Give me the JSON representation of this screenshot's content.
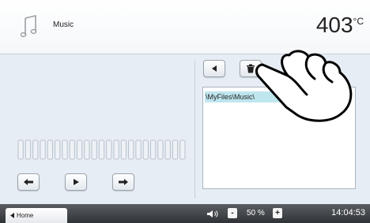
{
  "header": {
    "app_icon": "music-note-icon",
    "title": "Music",
    "temperature": "403",
    "temperature_unit": "°C"
  },
  "player": {
    "prev_icon": "arrow-left-icon",
    "play_icon": "play-icon",
    "next_icon": "arrow-right-icon",
    "level_segments": 23
  },
  "files": {
    "back_icon": "triangle-left-icon",
    "delete_icon": "trash-icon",
    "current_path": "\\MyFiles\\Music\\"
  },
  "footer": {
    "home_label": "Home",
    "home_icon": "triangle-left-icon",
    "speaker_icon": "speaker-icon",
    "vol_down": "-",
    "vol_up": "+",
    "volume": "50 %",
    "time": "14:04:53"
  },
  "overlay": {
    "hand_icon": "pointing-hand-icon"
  },
  "colors": {
    "accent": "#bfe6ee",
    "footer_bg": "#3a3d41",
    "content_bg": "#e7edf4"
  }
}
